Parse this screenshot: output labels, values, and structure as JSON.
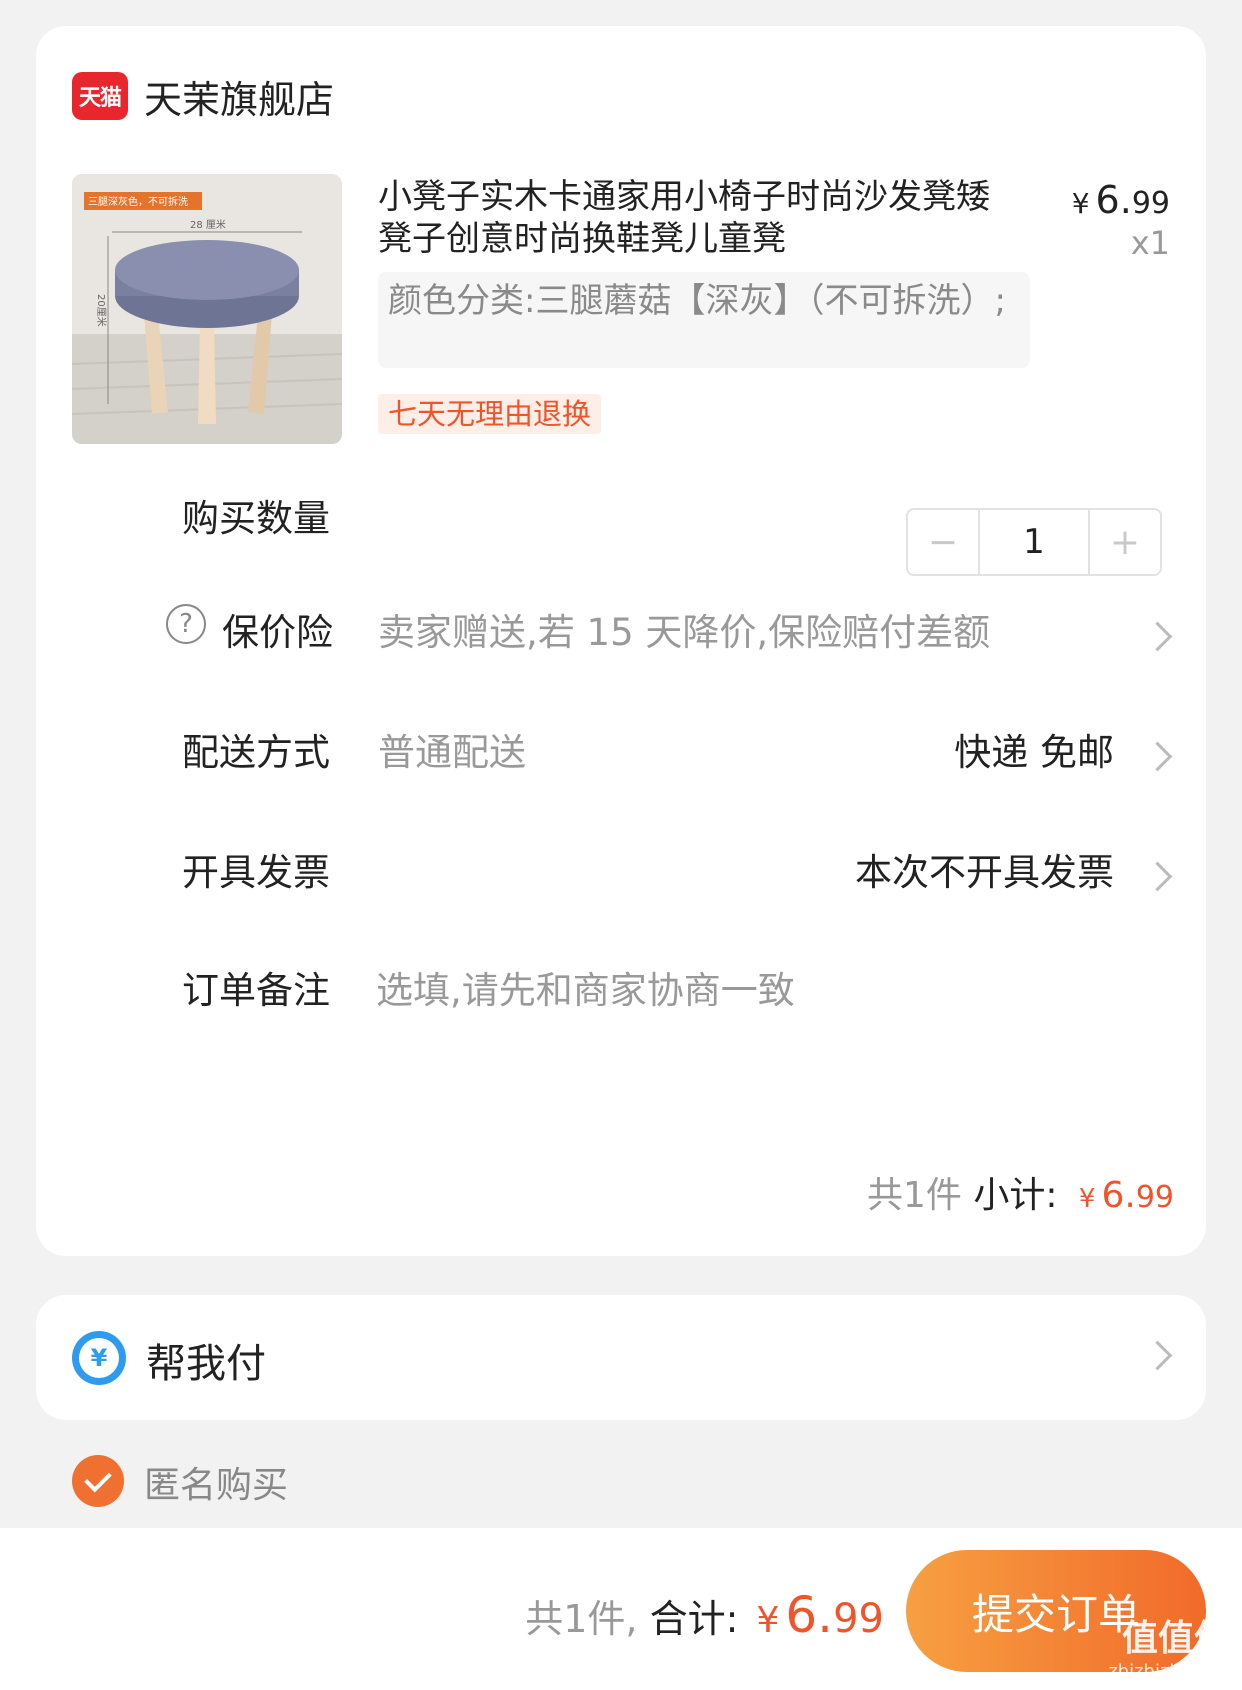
{
  "store": {
    "logo_text": "天猫",
    "name": "天茉旗舰店"
  },
  "product": {
    "title": "小凳子实木卡通家用小椅子时尚沙发凳矮凳子创意时尚换鞋凳儿童凳",
    "price_symbol": "¥",
    "price_int": "6.",
    "price_frac": "99",
    "quantity_label": "x1",
    "sku": "颜色分类:三腿蘑菇【深灰】（不可拆洗）;",
    "service_tag": "七天无理由退换",
    "thumb_badge": "三腿深灰色，不可拆洗",
    "thumb_width_label": "28 厘米",
    "thumb_height_label": "20厘米"
  },
  "rows": {
    "quantity": {
      "label": "购买数量",
      "value": "1",
      "minus": "−",
      "plus": "+"
    },
    "insurance": {
      "label": "保价险",
      "help": "?",
      "text": "卖家赠送,若 15 天降价,保险赔付差额"
    },
    "delivery": {
      "label": "配送方式",
      "text": "普通配送",
      "value": "快递 免邮"
    },
    "invoice": {
      "label": "开具发票",
      "value": "本次不开具发票"
    },
    "note": {
      "label": "订单备注",
      "placeholder": "选填,请先和商家协商一致"
    }
  },
  "subtotal": {
    "count": "共1件",
    "label": "小计:",
    "symbol": "¥",
    "amount_int": "6.",
    "amount_frac": "99"
  },
  "pay_for_me": {
    "icon": "¥",
    "label": "帮我付"
  },
  "anonymous": {
    "label": "匿名购买",
    "checked": true
  },
  "footer": {
    "count": "共1件,",
    "label": "合计:",
    "symbol": "¥",
    "amount_int": "6.",
    "amount_frac": "99",
    "submit": "提交订单",
    "watermark_logo": "值值值",
    "watermark_url": "zhizhizhi.com"
  },
  "colors": {
    "accent": "#f1542a",
    "tmall_red": "#e8262d",
    "pay_blue": "#2d9cf0",
    "button_start": "#f7a042",
    "button_end": "#f16a2a"
  }
}
